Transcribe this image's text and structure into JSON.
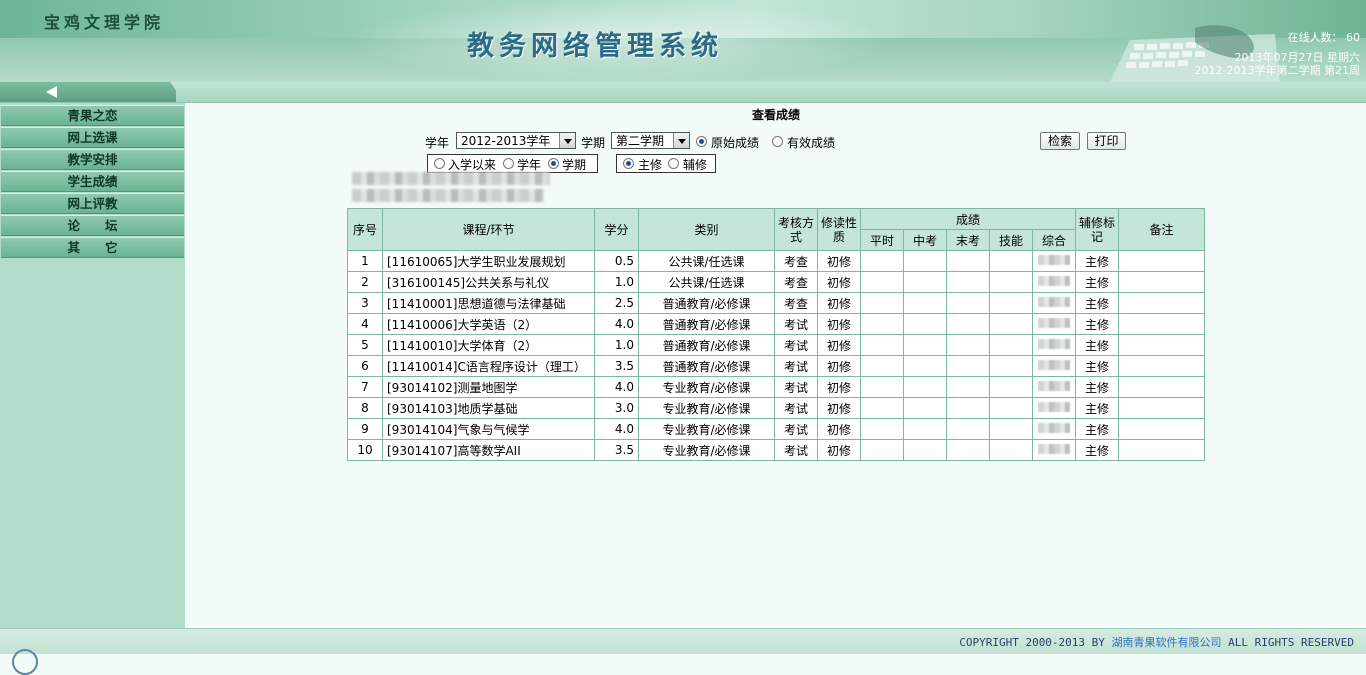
{
  "header": {
    "school_name": "宝鸡文理学院",
    "system_title": "教务网络管理系统",
    "online_count": "在线人数： 60",
    "date_line": "2013年07月27日 星期六",
    "term_line": "2012-2013学年第二学期 第21周"
  },
  "sidebar": {
    "items": [
      {
        "label": "青果之恋"
      },
      {
        "label": "网上选课"
      },
      {
        "label": "教学安排"
      },
      {
        "label": "学生成绩"
      },
      {
        "label": "网上评教"
      },
      {
        "label": "论　　坛"
      },
      {
        "label": "其　　它"
      }
    ]
  },
  "main": {
    "heading": "查看成绩",
    "year_label": "学年",
    "year_value": "2012-2013学年",
    "term_label": "学期",
    "term_value": "第二学期",
    "score_type": {
      "raw": "原始成绩",
      "effective": "有效成绩",
      "selected": "raw"
    },
    "search_button": "检索",
    "print_button": "打印",
    "range": {
      "since_enrollment": "入学以来",
      "year": "学年",
      "term": "学期",
      "selected": "term"
    },
    "major": {
      "main": "主修",
      "minor": "辅修",
      "selected": "main"
    }
  },
  "table": {
    "headers": {
      "no": "序号",
      "course": "课程/环节",
      "credit": "学分",
      "category": "类别",
      "exam_method": "考核方式",
      "study_nature": "修读性质",
      "scores": "成绩",
      "usual": "平时",
      "midterm": "中考",
      "final": "末考",
      "skill": "技能",
      "total": "综合",
      "minor_flag": "辅修标记",
      "remark": "备注"
    },
    "rows": [
      {
        "no": "1",
        "course": "[11610065]大学生职业发展规划",
        "credit": "0.5",
        "category": "公共课/任选课",
        "exam": "考查",
        "nature": "初修",
        "flag": "主修"
      },
      {
        "no": "2",
        "course": "[316100145]公共关系与礼仪",
        "credit": "1.0",
        "category": "公共课/任选课",
        "exam": "考查",
        "nature": "初修",
        "flag": "主修"
      },
      {
        "no": "3",
        "course": "[11410001]思想道德与法律基础",
        "credit": "2.5",
        "category": "普通教育/必修课",
        "exam": "考查",
        "nature": "初修",
        "flag": "主修"
      },
      {
        "no": "4",
        "course": "[11410006]大学英语（2）",
        "credit": "4.0",
        "category": "普通教育/必修课",
        "exam": "考试",
        "nature": "初修",
        "flag": "主修"
      },
      {
        "no": "5",
        "course": "[11410010]大学体育（2）",
        "credit": "1.0",
        "category": "普通教育/必修课",
        "exam": "考试",
        "nature": "初修",
        "flag": "主修"
      },
      {
        "no": "6",
        "course": "[11410014]C语言程序设计（理工）",
        "credit": "3.5",
        "category": "普通教育/必修课",
        "exam": "考试",
        "nature": "初修",
        "flag": "主修"
      },
      {
        "no": "7",
        "course": "[93014102]测量地图学",
        "credit": "4.0",
        "category": "专业教育/必修课",
        "exam": "考试",
        "nature": "初修",
        "flag": "主修"
      },
      {
        "no": "8",
        "course": "[93014103]地质学基础",
        "credit": "3.0",
        "category": "专业教育/必修课",
        "exam": "考试",
        "nature": "初修",
        "flag": "主修"
      },
      {
        "no": "9",
        "course": "[93014104]气象与气候学",
        "credit": "4.0",
        "category": "专业教育/必修课",
        "exam": "考试",
        "nature": "初修",
        "flag": "主修"
      },
      {
        "no": "10",
        "course": "[93014107]高等数学AII",
        "credit": "3.5",
        "category": "专业教育/必修课",
        "exam": "考试",
        "nature": "初修",
        "flag": "主修"
      }
    ]
  },
  "footer": {
    "copyright_prefix": "COPYRIGHT 2000-2013 BY ",
    "company": "湖南青果软件有限公司",
    "copyright_suffix": " ALL RIGHTS RESERVED"
  }
}
